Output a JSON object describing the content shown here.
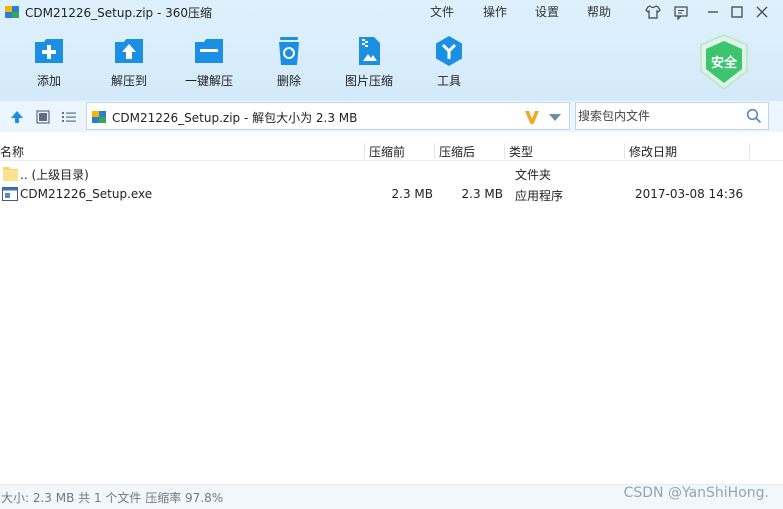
{
  "window": {
    "title": "CDM21226_Setup.zip - 360压缩",
    "menu": [
      "文件",
      "操作",
      "设置",
      "帮助"
    ]
  },
  "toolbar": {
    "items": [
      {
        "label": "添加",
        "icon": "add-icon"
      },
      {
        "label": "解压到",
        "icon": "extract-to-icon"
      },
      {
        "label": "一键解压",
        "icon": "one-click-extract-icon"
      },
      {
        "label": "删除",
        "icon": "delete-icon"
      },
      {
        "label": "图片压缩",
        "icon": "image-compress-icon"
      },
      {
        "label": "工具",
        "icon": "tools-icon"
      }
    ],
    "security_badge": "安全"
  },
  "address": {
    "path": "CDM21226_Setup.zip - 解包大小为 2.3 MB",
    "search_placeholder": "搜索包内文件"
  },
  "table": {
    "headers": {
      "name": "名称",
      "compressed_before": "压缩前",
      "compressed_after": "压缩后",
      "type": "类型",
      "modified": "修改日期"
    },
    "rows": [
      {
        "name": ".. (上级目录)",
        "before": "",
        "after": "",
        "type": "文件夹",
        "modified": ""
      },
      {
        "name": "CDM21226_Setup.exe",
        "before": "2.3 MB",
        "after": "2.3 MB",
        "type": "应用程序",
        "modified": "2017-03-08 14:36"
      }
    ]
  },
  "status": {
    "text": "大小: 2.3 MB 共 1 个文件 压缩率 97.8%",
    "watermark": "CSDN @YanShiHong."
  },
  "colors": {
    "accent": "#1a8fe3",
    "toolbar_bg": "#d8edfb",
    "shield": "#3cc46e",
    "vip": "#f5a623"
  }
}
